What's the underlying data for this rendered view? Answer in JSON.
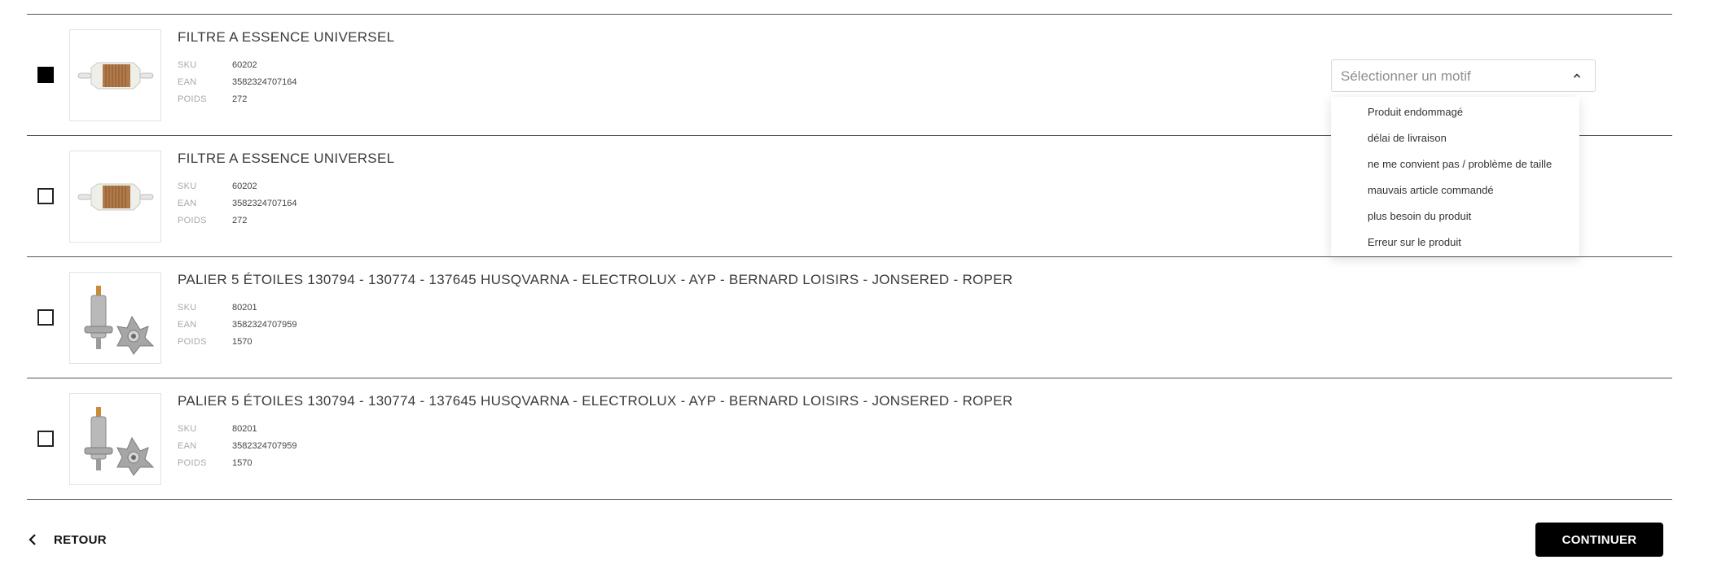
{
  "items": [
    {
      "title": "FILTRE A ESSENCE UNIVERSEL",
      "checked": true,
      "image": "fuel-filter-image",
      "sku_label": "SKU",
      "sku": "60202",
      "ean_label": "EAN",
      "ean": "3582324707164",
      "weight_label": "POIDS",
      "weight": "272"
    },
    {
      "title": "FILTRE A ESSENCE UNIVERSEL",
      "checked": false,
      "image": "fuel-filter-image",
      "sku_label": "SKU",
      "sku": "60202",
      "ean_label": "EAN",
      "ean": "3582324707164",
      "weight_label": "POIDS",
      "weight": "272"
    },
    {
      "title": "PALIER 5 ÉTOILES 130794 - 130774 - 137645 HUSQVARNA - ELECTROLUX - AYP - BERNARD LOISIRS - JONSERED - ROPER",
      "checked": false,
      "image": "spindle-bearing-image",
      "sku_label": "SKU",
      "sku": "80201",
      "ean_label": "EAN",
      "ean": "3582324707959",
      "weight_label": "POIDS",
      "weight": "1570"
    },
    {
      "title": "PALIER 5 ÉTOILES 130794 - 130774 - 137645 HUSQVARNA - ELECTROLUX - AYP - BERNARD LOISIRS - JONSERED - ROPER",
      "checked": false,
      "image": "spindle-bearing-image",
      "sku_label": "SKU",
      "sku": "80201",
      "ean_label": "EAN",
      "ean": "3582324707959",
      "weight_label": "POIDS",
      "weight": "1570"
    }
  ],
  "reason_select": {
    "placeholder": "Sélectionner un motif",
    "icon": "chevron-up-icon",
    "options": [
      "Produit endommagé",
      "délai de livraison",
      "ne me convient pas / problème de taille",
      "mauvais article commandé",
      "plus besoin du produit",
      "Erreur sur le produit"
    ]
  },
  "footer": {
    "back_label": "RETOUR",
    "back_icon": "chevron-left-icon",
    "continue_label": "CONTINUER"
  },
  "colors": {
    "divider": "#555555",
    "primary_button": "#000000",
    "checked_box": "#000000"
  }
}
